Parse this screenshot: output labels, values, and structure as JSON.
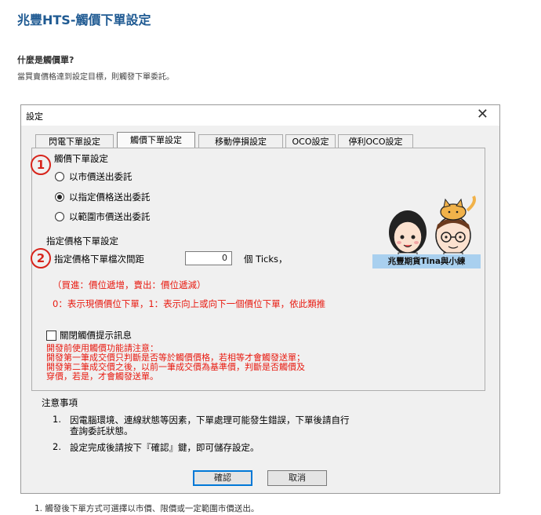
{
  "page": {
    "title": "兆豐HTS-觸價下單設定",
    "question": "什麼是觸價單?",
    "description": "當買賣價格達到設定目標，則觸發下單委託。",
    "footnote": "1. 觸發後下單方式可選擇以市價、限價或一定範圍市價送出。"
  },
  "dialog": {
    "title": "設定",
    "close_symbol": "✕",
    "tabs": [
      "閃電下單設定",
      "觸價下單設定",
      "移動停損設定",
      "OCO設定",
      "停利OCO設定"
    ],
    "active_tab": 1,
    "section1": {
      "marker": "1",
      "heading": "觸價下單設定",
      "options": [
        "以市價送出委託",
        "以指定價格送出委託",
        "以範圍市價送出委託"
      ],
      "selected": 1
    },
    "section2": {
      "marker": "2",
      "heading": "指定價格下單設定",
      "field_label": "指定價格下單檔次間距",
      "field_value": "0",
      "field_unit": "個 Ticks，",
      "note1": "（買進：價位遞增，賣出：價位遞減）",
      "note2": "0：表示現價價位下單，1：表示向上或向下一個價位下單，依此類推"
    },
    "checkbox_label": "關閉觸價提示訊息",
    "warning": [
      "開發前使用觸價功能請注意：",
      "開發第一筆成交價只判斷是否等於觸價價格，若相等才會觸發送單；",
      "開發第二筆成交價之後，以前一筆成交價為基準價，判斷是否觸價及",
      "穿價，若是，才會觸發送單。"
    ],
    "notes_heading": "注意事項",
    "notes": [
      {
        "num": "1.",
        "text": "因電腦環境、連線狀態等因素，下單處理可能發生錯誤，下單後請自行",
        "cont": "查詢委託狀態。"
      },
      {
        "num": "2.",
        "text": "設定完成後請按下『確認』鍵，即可儲存設定。",
        "cont": ""
      }
    ],
    "confirm_label": "確認",
    "cancel_label": "取消"
  },
  "sticker": {
    "caption": "兆豐期貨Tina與小練",
    "icon": "cartoon-characters-illustration"
  },
  "colors": {
    "title_blue": "#1f5a92",
    "warning_red": "#e8190f",
    "marker_red": "#d7241b",
    "badge_blue": "#a9d0ef"
  }
}
